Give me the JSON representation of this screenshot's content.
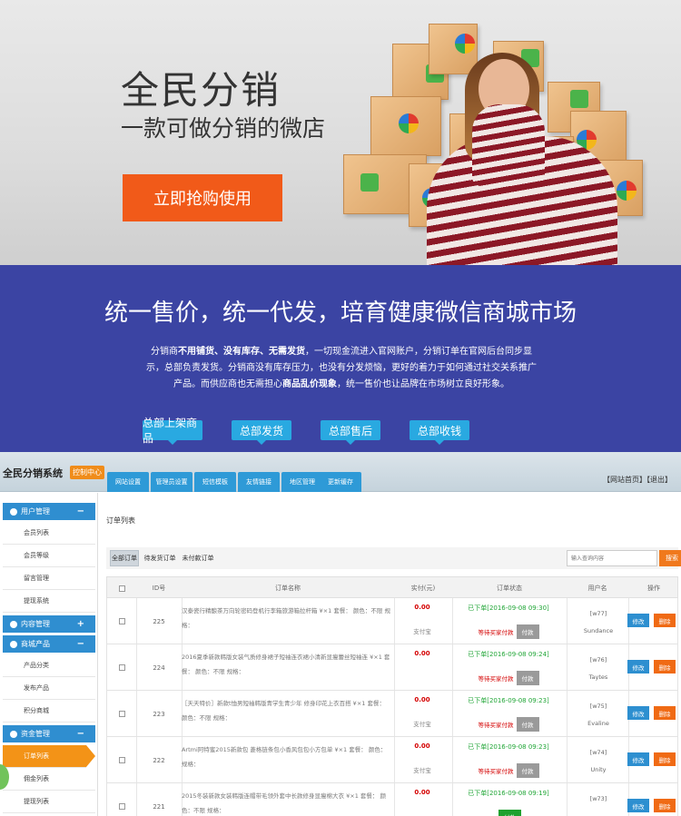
{
  "hero": {
    "title": "全民分销",
    "subtitle": "一款可做分销的微店",
    "cta_label": "立即抢购使用"
  },
  "banner": {
    "headline": "统一售价，统一代发，培育健康微信商城市场",
    "desc_1": "分销商",
    "desc_b1": "不用铺货、没有库存、无需发货",
    "desc_2": "，一切现金流进入官网账户，分销订单在官网后台同步显示，总部负责发货。分销商没有库存压力，也没有分发烦恼，更好的着力于如何通过社交关系推广产品。而供应商也无需担心",
    "desc_b2": "商品乱价现象",
    "desc_3": "，统一售价也让品牌在市场树立良好形象。",
    "buttons": [
      "总部上架商品",
      "总部发货",
      "总部售后",
      "总部收钱"
    ]
  },
  "admin": {
    "system_name": "全民分销系统",
    "control_center": "控制中心",
    "nav_tabs": [
      "网站设置",
      "管理员设置",
      "短信模板",
      "友情链接",
      "地区管理",
      "更新缓存"
    ],
    "top_links": "【网站首页】【退出】",
    "sidebar": {
      "sections": [
        {
          "label": "用户管理",
          "toggle": "−",
          "items": [
            "会员列表",
            "会员等级",
            "留言管理",
            "提现系统"
          ]
        },
        {
          "label": "内容管理",
          "toggle": "+",
          "items": []
        },
        {
          "label": "商城产品",
          "toggle": "−",
          "items": [
            "产品分类",
            "发布产品",
            "积分商城"
          ]
        },
        {
          "label": "资金管理",
          "toggle": "−",
          "items": [
            "订单列表",
            "佣金列表",
            "提现列表"
          ]
        }
      ]
    },
    "breadcrumb": "订单列表",
    "filter_tabs": [
      "全部订单",
      "待发货订单",
      "未付款订单"
    ],
    "search_placeholder": "输入查询内容",
    "search_label": "搜索",
    "columns": [
      "",
      "ID号",
      "订单名称",
      "实付(元)",
      "订单状态",
      "用户名",
      "操作"
    ],
    "rows": [
      {
        "id": "225",
        "name": "汉泰瓷行精酿茶万向轮密码登机行李箱旅游箱拉杆箱   ¥×1   套餐：   颜色：不限   规格：",
        "price": "0.00",
        "pay": "支付宝",
        "status": "已下单[2016-09-08 09:30]",
        "wait": "等待买家付款",
        "pay_btn": "付款",
        "user": "[w77]",
        "user_name": "Sundance",
        "edit": "修改",
        "del": "删除"
      },
      {
        "id": "224",
        "name": "2016夏季新款韩版女装气质修身裙子短袖连衣裙小清新显瘦蕾丝短袖连   ¥×1   套餐：   颜色：不限   规格：",
        "price": "0.00",
        "pay": "",
        "status": "已下单[2016-09-08 09:24]",
        "wait": "等待买家付款",
        "pay_btn": "付款",
        "user": "[w76]",
        "user_name": "Taytes",
        "edit": "修改",
        "del": "删除"
      },
      {
        "id": "223",
        "name": "［天天特价］新款t恤男短袖韩版青学生青少年 修身印花上衣百搭   ¥×1   套餐：   颜色：不限   规格：",
        "price": "0.00",
        "pay": "支付宝",
        "status": "已下单[2016-09-08 09:23]",
        "wait": "等待买家付款",
        "pay_btn": "付款",
        "user": "[w75]",
        "user_name": "Evaline",
        "edit": "修改",
        "del": "删除"
      },
      {
        "id": "222",
        "name": "Artmi阿特蜜2015新款包 菱格链条包小香风包包小方包单   ¥×1   套餐：   颜色：   规格：",
        "price": "0.00",
        "pay": "支付宝",
        "status": "已下单[2016-09-08 09:23]",
        "wait": "等待买家付款",
        "pay_btn": "付款",
        "user": "[w74]",
        "user_name": "Unity",
        "edit": "修改",
        "del": "删除"
      },
      {
        "id": "221",
        "name": "2015冬装新款女装韩版连帽带毛领外套中长款修身显瘦棉大衣   ¥×1   套餐：   颜色：不限   规格：",
        "price": "0.00",
        "pay": "",
        "status": "已下单[2016-09-08 09:19]",
        "wait": "",
        "pay_btn": "付款",
        "user": "[w73]",
        "user_name": "",
        "edit": "修改",
        "del": "删除"
      }
    ]
  },
  "colors": {
    "accent": "#f15a19",
    "banner_bg": "#3b44a3",
    "nav_blue": "#2e9ad7",
    "active_orange": "#f39317"
  }
}
